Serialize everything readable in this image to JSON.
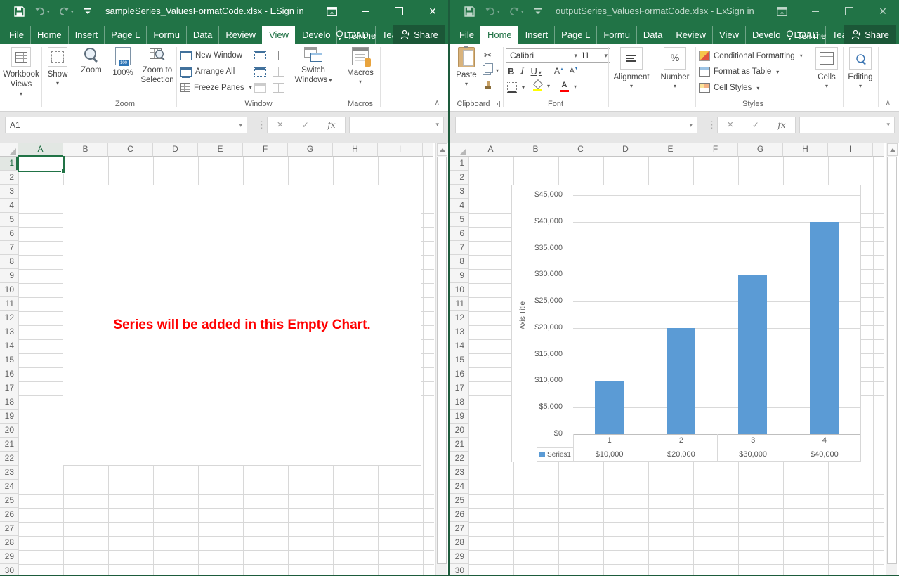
{
  "colors": {
    "excel_green": "#217346",
    "share_green": "#1B5737",
    "bar_blue": "#5B9BD5",
    "note_red": "#FF0000",
    "chart_text": "#595959",
    "gridline": "#D9D9D9"
  },
  "chrome": {
    "tabs": [
      "File",
      "Home",
      "Insert",
      "Page L",
      "Formu",
      "Data",
      "Review",
      "View",
      "Develo",
      "LOAD",
      "Team"
    ],
    "tell_me": "Tell me",
    "share": "Share",
    "sign_in": "Sign in",
    "qat_icons": [
      "save-icon",
      "undo-icon",
      "redo-icon",
      "customize-quick-access-toolbar-icon"
    ],
    "window_control_icons": [
      "ribbon-display-options-icon",
      "minimize-icon",
      "maximize-icon",
      "close-icon"
    ]
  },
  "grid": {
    "columns": [
      "A",
      "B",
      "C",
      "D",
      "E",
      "F",
      "G",
      "H",
      "I"
    ],
    "rows": [
      "1",
      "2",
      "3",
      "4",
      "5",
      "6",
      "7",
      "8",
      "9",
      "10",
      "11",
      "12",
      "13",
      "14",
      "15",
      "16",
      "17",
      "18",
      "19",
      "20",
      "21",
      "22",
      "23",
      "24",
      "25",
      "26",
      "27",
      "28",
      "29",
      "30"
    ]
  },
  "formula_bar": {
    "fx_label": "fx"
  },
  "left_window": {
    "title": "sampleSeries_ValuesFormatCode.xlsx  -  E...",
    "active_tab": "View",
    "name_box": "A1",
    "formula_value": "",
    "selected_column": "A",
    "selected_row": "1",
    "ribbon": {
      "workbook_views": "Workbook Views",
      "show": "Show",
      "zoom_group": "Zoom",
      "zoom": "Zoom",
      "hundred": "100%",
      "zoom_to_selection": "Zoom to Selection",
      "window_group": "Window",
      "new_window": "New Window",
      "arrange_all": "Arrange All",
      "freeze_panes": "Freeze Panes",
      "switch_windows": "Switch Windows",
      "macros_group": "Macros",
      "macros": "Macros"
    },
    "chart_note": "Series will be added in this Empty Chart."
  },
  "right_window": {
    "title": "outputSeries_ValuesFormatCode.xlsx  -  Ex...",
    "active_tab": "Home",
    "name_box": "",
    "formula_value": "",
    "ribbon": {
      "clipboard_group": "Clipboard",
      "paste": "Paste",
      "font_group": "Font",
      "font_name": "Calibri",
      "font_size": "11",
      "bold": "B",
      "italic": "I",
      "underline": "U",
      "alignment": "Alignment",
      "number": "Number",
      "percent": "%",
      "styles_group": "Styles",
      "conditional_formatting": "Conditional Formatting",
      "format_as_table": "Format as Table",
      "cell_styles": "Cell Styles",
      "cells": "Cells",
      "editing": "Editing"
    }
  },
  "chart_data": {
    "type": "bar",
    "title": "",
    "xlabel": "",
    "ylabel": "Axis Title",
    "categories": [
      "1",
      "2",
      "3",
      "4"
    ],
    "series": [
      {
        "name": "Series1",
        "values": [
          10000,
          20000,
          30000,
          40000
        ],
        "formatted_values": [
          "$10,000",
          "$20,000",
          "$30,000",
          "$40,000"
        ]
      }
    ],
    "y_ticks": [
      "$45,000",
      "$40,000",
      "$35,000",
      "$30,000",
      "$25,000",
      "$20,000",
      "$15,000",
      "$10,000",
      "$5,000",
      "$0"
    ],
    "ylim": [
      0,
      45000
    ],
    "gridlines": true,
    "legend_position": "data-table-left",
    "data_table": true,
    "bar_color": "#5B9BD5"
  }
}
